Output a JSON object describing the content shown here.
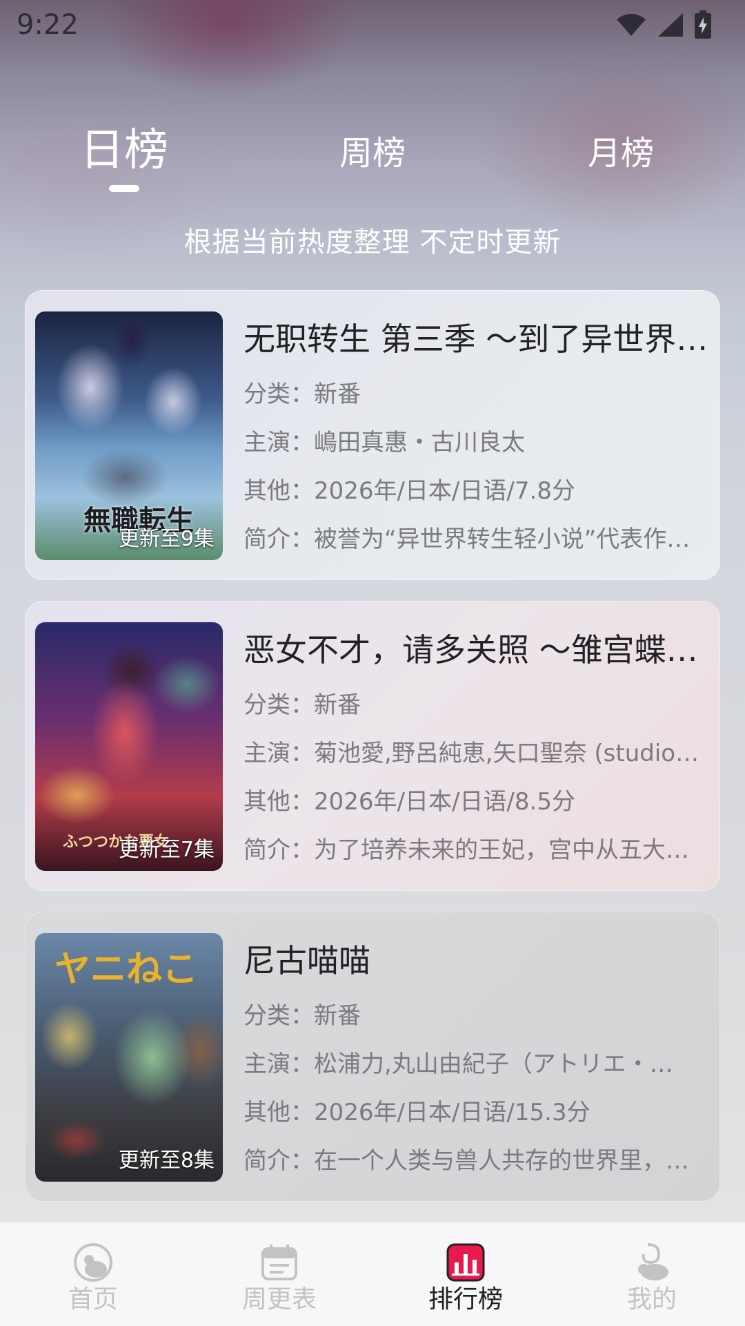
{
  "status_bar": {
    "time": "9:22"
  },
  "tabs": [
    {
      "label": "日榜",
      "active": true
    },
    {
      "label": "周榜",
      "active": false
    },
    {
      "label": "月榜",
      "active": false
    }
  ],
  "subtitle": "根据当前热度整理 不定时更新",
  "items": [
    {
      "title": "无职转生 第三季 ～到了异世界就拿出真本事～",
      "category": "分类：新番",
      "cast": "主演：嶋田真惠・古川良太",
      "other": "其他：2026年/日本/日语/7.8分",
      "summary": "简介：被誉为“异世界转生轻小说”代表作…",
      "episodes": "更新至9集",
      "poster_text": "無職転生"
    },
    {
      "title": "恶女不才，请多关照 ～雏宫蝶…",
      "category": "分类：新番",
      "cast": "主演：菊池愛,野呂純恵,矢口聖奈 (studio…",
      "other": "其他：2026年/日本/日语/8.5分",
      "summary": "简介：为了培养未来的王妃，宫中从五大…",
      "episodes": "更新至7集",
      "poster_text": "ふつつかな悪女"
    },
    {
      "title": "尼古喵喵",
      "category": "分类：新番",
      "cast": "主演：松浦力,丸山由紀子（アトリエ・…",
      "other": "其他：2026年/日本/日语/15.3分",
      "summary": "简介：在一个人类与兽人共存的世界里，…",
      "episodes": "更新至8集",
      "poster_text": "ヤニねこ"
    }
  ],
  "nav": [
    {
      "label": "首页",
      "icon": "home-icon",
      "active": false
    },
    {
      "label": "周更表",
      "icon": "calendar-icon",
      "active": false
    },
    {
      "label": "排行榜",
      "icon": "ranking-icon",
      "active": true
    },
    {
      "label": "我的",
      "icon": "profile-icon",
      "active": false
    }
  ],
  "colors": {
    "accent": "#e8194d",
    "nav_inactive": "#c3c3c6",
    "nav_active": "#202024"
  }
}
